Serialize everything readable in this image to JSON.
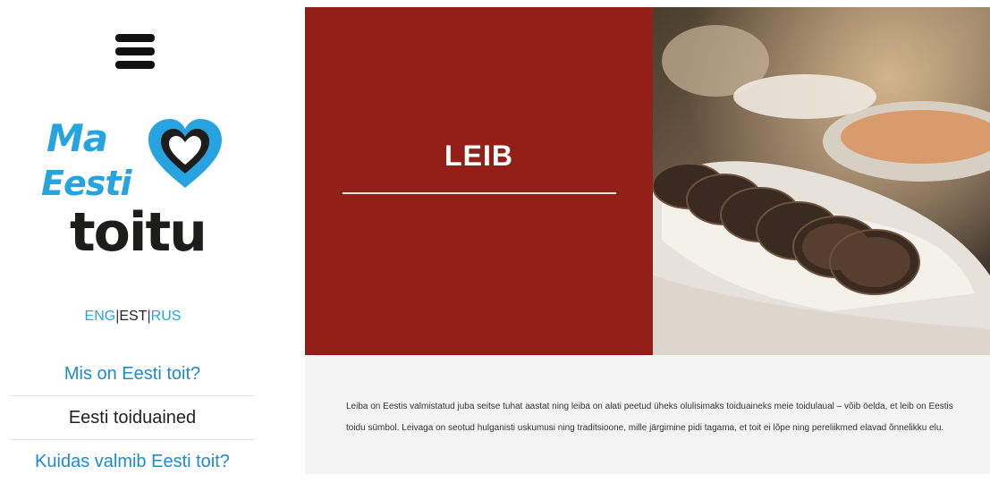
{
  "sidebar": {
    "logo_words": [
      "Ma",
      "Eesti",
      "toitu"
    ],
    "languages": [
      {
        "label": "ENG"
      },
      {
        "label": "EST"
      },
      {
        "label": "RUS"
      }
    ],
    "separator": "|",
    "nav": [
      {
        "label": "Mis on Eesti toit?"
      },
      {
        "label": "Eesti toiduained"
      },
      {
        "label": "Kuidas valmib Eesti toit?"
      }
    ]
  },
  "hero": {
    "title": "LEIB"
  },
  "content": {
    "body": "Leiba on Eestis valmistatud juba seitse tuhat aastat ning leiba on alati peetud üheks olulisimaks toiduaineks meie toidulaual – võib öelda, et leib on Eestis toidu sümbol. Leivaga on seotud hulganisti uskumusi ning traditsioone, mille järgimine pidi tagama, et toit ei lõpe ning pereliikmed elavad õnnelikku elu."
  },
  "colors": {
    "brand_blue": "#27a4e0",
    "hero_red": "#932018",
    "nav_blue": "#1d8ad2"
  },
  "icons": [
    "hamburger-menu-icon",
    "heart-icon"
  ]
}
